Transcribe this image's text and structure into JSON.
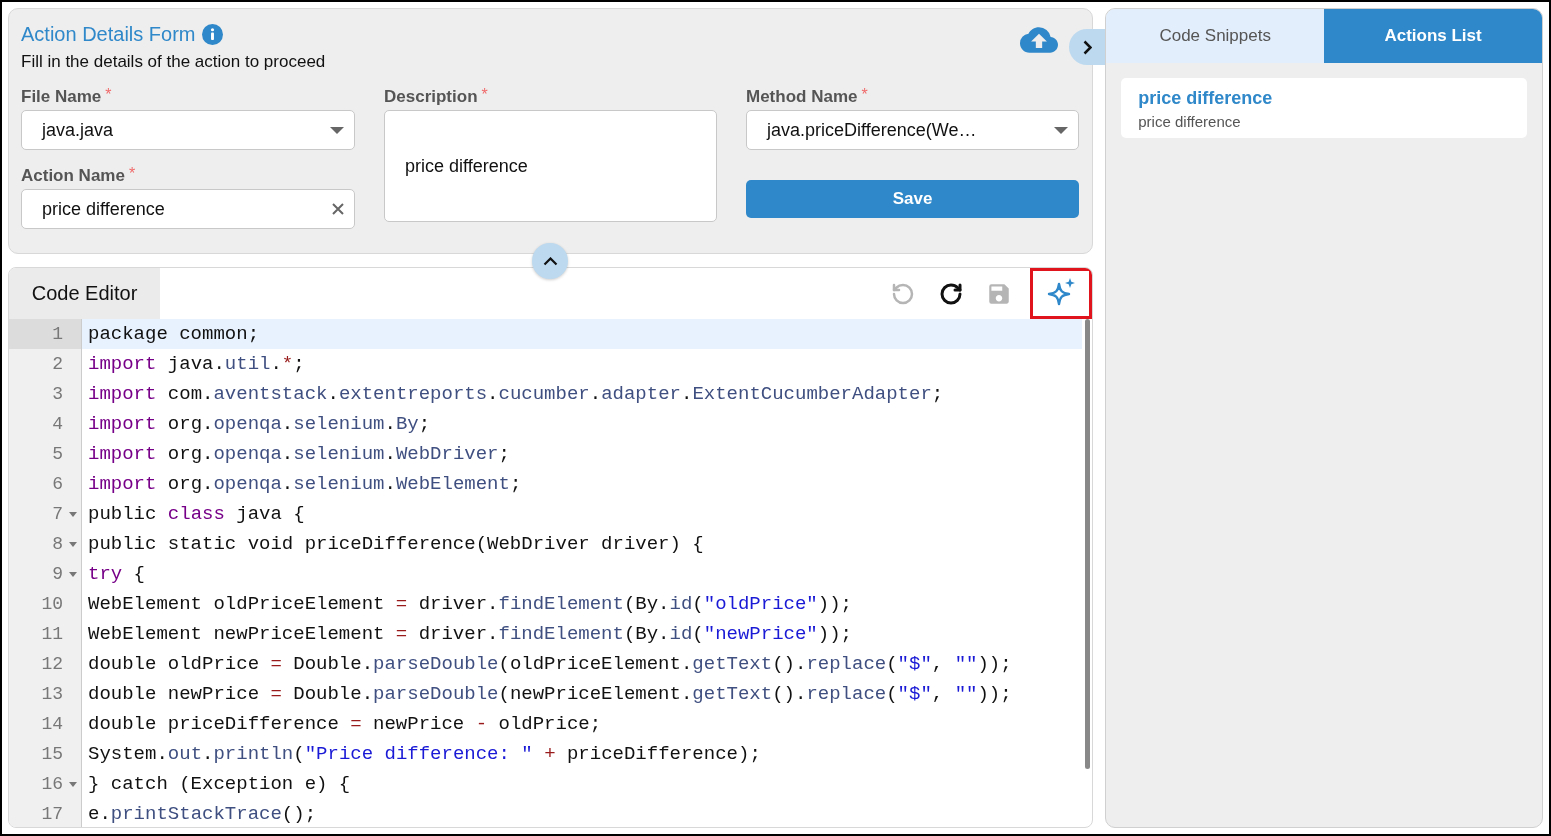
{
  "form": {
    "title": "Action Details Form",
    "subtitle": "Fill in the details of the action to proceed",
    "file_name": {
      "label": "File Name",
      "required_mark": "*",
      "value": "java.java"
    },
    "action_name": {
      "label": "Action Name",
      "required_mark": "*",
      "value": "price difference"
    },
    "description": {
      "label": "Description",
      "required_mark": "*",
      "value": "price difference"
    },
    "method_name": {
      "label": "Method Name",
      "required_mark": "*",
      "value": "java.priceDifference(We…"
    },
    "save_button": "Save"
  },
  "editor": {
    "tab": "Code Editor",
    "toolbar": [
      {
        "kind": "undo",
        "disabled": true,
        "highlighted": false
      },
      {
        "kind": "redo",
        "disabled": false,
        "highlighted": false
      },
      {
        "kind": "save",
        "disabled": true,
        "highlighted": false
      },
      {
        "kind": "ai",
        "disabled": false,
        "highlighted": true
      }
    ],
    "lines": [
      {
        "num": "1",
        "fold": false,
        "active": true,
        "tokens": [
          {
            "kind": "plain",
            "t": "package common;"
          }
        ]
      },
      {
        "num": "2",
        "fold": false,
        "active": false,
        "tokens": [
          {
            "kind": "keyword",
            "t": "import"
          },
          {
            "kind": "plain",
            "t": " java."
          },
          {
            "kind": "property",
            "t": "util"
          },
          {
            "kind": "plain",
            "t": "."
          },
          {
            "kind": "operator",
            "t": "*"
          },
          {
            "kind": "plain",
            "t": ";"
          }
        ]
      },
      {
        "num": "3",
        "fold": false,
        "active": false,
        "tokens": [
          {
            "kind": "keyword",
            "t": "import"
          },
          {
            "kind": "plain",
            "t": " com."
          },
          {
            "kind": "property",
            "t": "aventstack"
          },
          {
            "kind": "plain",
            "t": "."
          },
          {
            "kind": "property",
            "t": "extentreports"
          },
          {
            "kind": "plain",
            "t": "."
          },
          {
            "kind": "property",
            "t": "cucumber"
          },
          {
            "kind": "plain",
            "t": "."
          },
          {
            "kind": "property",
            "t": "adapter"
          },
          {
            "kind": "plain",
            "t": "."
          },
          {
            "kind": "property",
            "t": "ExtentCucumberAdapter"
          },
          {
            "kind": "plain",
            "t": ";"
          }
        ]
      },
      {
        "num": "4",
        "fold": false,
        "active": false,
        "tokens": [
          {
            "kind": "keyword",
            "t": "import"
          },
          {
            "kind": "plain",
            "t": " org."
          },
          {
            "kind": "property",
            "t": "openqa"
          },
          {
            "kind": "plain",
            "t": "."
          },
          {
            "kind": "property",
            "t": "selenium"
          },
          {
            "kind": "plain",
            "t": "."
          },
          {
            "kind": "property",
            "t": "By"
          },
          {
            "kind": "plain",
            "t": ";"
          }
        ]
      },
      {
        "num": "5",
        "fold": false,
        "active": false,
        "tokens": [
          {
            "kind": "keyword",
            "t": "import"
          },
          {
            "kind": "plain",
            "t": " org."
          },
          {
            "kind": "property",
            "t": "openqa"
          },
          {
            "kind": "plain",
            "t": "."
          },
          {
            "kind": "property",
            "t": "selenium"
          },
          {
            "kind": "plain",
            "t": "."
          },
          {
            "kind": "property",
            "t": "WebDriver"
          },
          {
            "kind": "plain",
            "t": ";"
          }
        ]
      },
      {
        "num": "6",
        "fold": false,
        "active": false,
        "tokens": [
          {
            "kind": "keyword",
            "t": "import"
          },
          {
            "kind": "plain",
            "t": " org."
          },
          {
            "kind": "property",
            "t": "openqa"
          },
          {
            "kind": "plain",
            "t": "."
          },
          {
            "kind": "property",
            "t": "selenium"
          },
          {
            "kind": "plain",
            "t": "."
          },
          {
            "kind": "property",
            "t": "WebElement"
          },
          {
            "kind": "plain",
            "t": ";"
          }
        ]
      },
      {
        "num": "7",
        "fold": true,
        "active": false,
        "tokens": [
          {
            "kind": "plain",
            "t": "public "
          },
          {
            "kind": "keyword",
            "t": "class"
          },
          {
            "kind": "plain",
            "t": " java {"
          }
        ]
      },
      {
        "num": "8",
        "fold": true,
        "active": false,
        "tokens": [
          {
            "kind": "plain",
            "t": "public static void priceDifference(WebDriver driver) {"
          }
        ]
      },
      {
        "num": "9",
        "fold": true,
        "active": false,
        "tokens": [
          {
            "kind": "keyword",
            "t": "try"
          },
          {
            "kind": "plain",
            "t": " {"
          }
        ]
      },
      {
        "num": "10",
        "fold": false,
        "active": false,
        "tokens": [
          {
            "kind": "plain",
            "t": "WebElement oldPriceElement "
          },
          {
            "kind": "operator",
            "t": "="
          },
          {
            "kind": "plain",
            "t": " driver."
          },
          {
            "kind": "property",
            "t": "findElement"
          },
          {
            "kind": "plain",
            "t": "(By."
          },
          {
            "kind": "property",
            "t": "id"
          },
          {
            "kind": "plain",
            "t": "("
          },
          {
            "kind": "string",
            "t": "\"oldPrice\""
          },
          {
            "kind": "plain",
            "t": "));"
          }
        ]
      },
      {
        "num": "11",
        "fold": false,
        "active": false,
        "tokens": [
          {
            "kind": "plain",
            "t": "WebElement newPriceElement "
          },
          {
            "kind": "operator",
            "t": "="
          },
          {
            "kind": "plain",
            "t": " driver."
          },
          {
            "kind": "property",
            "t": "findElement"
          },
          {
            "kind": "plain",
            "t": "(By."
          },
          {
            "kind": "property",
            "t": "id"
          },
          {
            "kind": "plain",
            "t": "("
          },
          {
            "kind": "string",
            "t": "\"newPrice\""
          },
          {
            "kind": "plain",
            "t": "));"
          }
        ]
      },
      {
        "num": "12",
        "fold": false,
        "active": false,
        "tokens": [
          {
            "kind": "plain",
            "t": "double oldPrice "
          },
          {
            "kind": "operator",
            "t": "="
          },
          {
            "kind": "plain",
            "t": " Double."
          },
          {
            "kind": "property",
            "t": "parseDouble"
          },
          {
            "kind": "plain",
            "t": "(oldPriceElement."
          },
          {
            "kind": "property",
            "t": "getText"
          },
          {
            "kind": "plain",
            "t": "()."
          },
          {
            "kind": "property",
            "t": "replace"
          },
          {
            "kind": "plain",
            "t": "("
          },
          {
            "kind": "string",
            "t": "\"$\""
          },
          {
            "kind": "plain",
            "t": ", "
          },
          {
            "kind": "string",
            "t": "\"\""
          },
          {
            "kind": "plain",
            "t": "));"
          }
        ]
      },
      {
        "num": "13",
        "fold": false,
        "active": false,
        "tokens": [
          {
            "kind": "plain",
            "t": "double newPrice "
          },
          {
            "kind": "operator",
            "t": "="
          },
          {
            "kind": "plain",
            "t": " Double."
          },
          {
            "kind": "property",
            "t": "parseDouble"
          },
          {
            "kind": "plain",
            "t": "(newPriceElement."
          },
          {
            "kind": "property",
            "t": "getText"
          },
          {
            "kind": "plain",
            "t": "()."
          },
          {
            "kind": "property",
            "t": "replace"
          },
          {
            "kind": "plain",
            "t": "("
          },
          {
            "kind": "string",
            "t": "\"$\""
          },
          {
            "kind": "plain",
            "t": ", "
          },
          {
            "kind": "string",
            "t": "\"\""
          },
          {
            "kind": "plain",
            "t": "));"
          }
        ]
      },
      {
        "num": "14",
        "fold": false,
        "active": false,
        "tokens": [
          {
            "kind": "plain",
            "t": "double priceDifference "
          },
          {
            "kind": "operator",
            "t": "="
          },
          {
            "kind": "plain",
            "t": " newPrice "
          },
          {
            "kind": "operator",
            "t": "-"
          },
          {
            "kind": "plain",
            "t": " oldPrice;"
          }
        ]
      },
      {
        "num": "15",
        "fold": false,
        "active": false,
        "tokens": [
          {
            "kind": "plain",
            "t": "System."
          },
          {
            "kind": "property",
            "t": "out"
          },
          {
            "kind": "plain",
            "t": "."
          },
          {
            "kind": "property",
            "t": "println"
          },
          {
            "kind": "plain",
            "t": "("
          },
          {
            "kind": "string",
            "t": "\"Price difference: \""
          },
          {
            "kind": "operator",
            "t": " +"
          },
          {
            "kind": "plain",
            "t": " priceDifference);"
          }
        ]
      },
      {
        "num": "16",
        "fold": true,
        "active": false,
        "tokens": [
          {
            "kind": "plain",
            "t": "} catch (Exception e) {"
          }
        ]
      },
      {
        "num": "17",
        "fold": false,
        "active": false,
        "tokens": [
          {
            "kind": "plain",
            "t": "e."
          },
          {
            "kind": "property",
            "t": "printStackTrace"
          },
          {
            "kind": "plain",
            "t": "();"
          }
        ]
      }
    ]
  },
  "side_panel": {
    "tabs": [
      {
        "label": "Code Snippets",
        "selected": false
      },
      {
        "label": "Actions List",
        "selected": true
      }
    ],
    "actions": [
      {
        "title": "price difference",
        "description": "price difference"
      }
    ]
  }
}
